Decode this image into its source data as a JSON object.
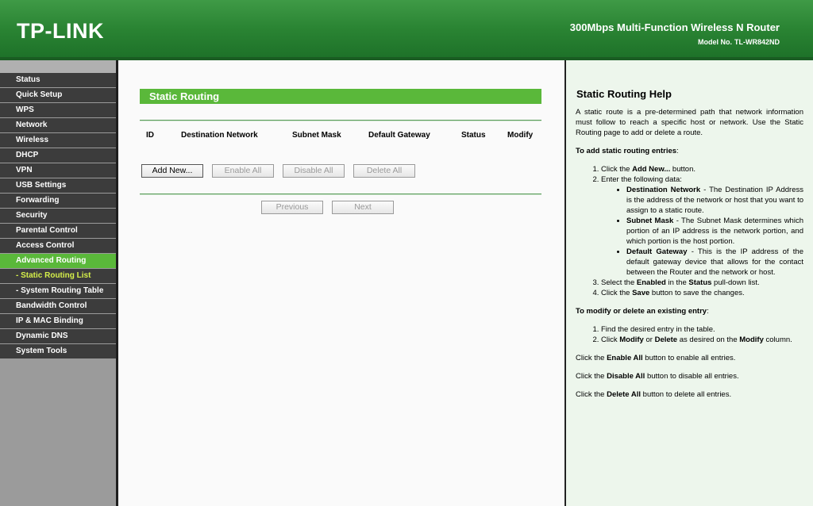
{
  "header": {
    "logo": "TP-LINK",
    "product": "300Mbps Multi-Function Wireless N Router",
    "model_label": "Model No.",
    "model_number": "TL-WR842ND"
  },
  "sidebar": {
    "items": [
      {
        "label": "Status"
      },
      {
        "label": "Quick Setup"
      },
      {
        "label": "WPS"
      },
      {
        "label": "Network"
      },
      {
        "label": "Wireless"
      },
      {
        "label": "DHCP"
      },
      {
        "label": "VPN"
      },
      {
        "label": "USB Settings"
      },
      {
        "label": "Forwarding"
      },
      {
        "label": "Security"
      },
      {
        "label": "Parental Control"
      },
      {
        "label": "Access Control"
      },
      {
        "label": "Advanced Routing"
      },
      {
        "label": "- Static Routing List"
      },
      {
        "label": "- System Routing Table"
      },
      {
        "label": "Bandwidth Control"
      },
      {
        "label": "IP & MAC Binding"
      },
      {
        "label": "Dynamic DNS"
      },
      {
        "label": "System Tools"
      }
    ]
  },
  "main": {
    "title": "Static Routing",
    "columns": [
      "ID",
      "Destination Network",
      "Subnet Mask",
      "Default Gateway",
      "Status",
      "Modify"
    ],
    "buttons": {
      "add_new": "Add New...",
      "enable_all": "Enable All",
      "disable_all": "Disable All",
      "delete_all": "Delete All",
      "previous": "Previous",
      "next": "Next"
    }
  },
  "help": {
    "title": "Static Routing Help",
    "intro": "A static route is a pre-determined path that network information must follow to reach a specific host or network. Use the Static Routing page to add or delete a route.",
    "add_heading": "To add static routing entries",
    "add_step1_pre": "Click the ",
    "add_step1_bold": "Add New...",
    "add_step1_post": " button.",
    "add_step2": "Enter the following data:",
    "dest_bold": "Destination Network",
    "dest_text": " - The Destination IP Address is the address of the network or host that you want to assign to a static route.",
    "mask_bold": "Subnet Mask",
    "mask_text": " - The Subnet Mask determines which portion of an IP address is the network portion, and which portion is the host portion.",
    "gw_bold": "Default Gateway",
    "gw_text": " - This is the IP address of the default gateway device that allows for the contact between the Router and the network or host.",
    "add_step3_pre": "Select the ",
    "add_step3_bold1": "Enabled",
    "add_step3_mid": " in the ",
    "add_step3_bold2": "Status",
    "add_step3_post": " pull-down list.",
    "add_step4_pre": "Click the ",
    "add_step4_bold": "Save",
    "add_step4_post": " button to save the changes.",
    "modify_heading": "To modify or delete an existing entry",
    "mod_step1": "Find the desired entry in the table.",
    "mod_step2_pre": "Click ",
    "mod_step2_bold1": "Modify",
    "mod_step2_or": " or ",
    "mod_step2_bold2": "Delete",
    "mod_step2_mid": " as desired on the ",
    "mod_step2_bold3": "Modify",
    "mod_step2_post": " column.",
    "enable_pre": "Click the ",
    "enable_bold": "Enable All",
    "enable_post": " button to enable all entries.",
    "disable_pre": "Click the ",
    "disable_bold": "Disable All",
    "disable_post": " button to disable all entries.",
    "delete_pre": "Click the ",
    "delete_bold": "Delete All",
    "delete_post": " button to delete all entries."
  },
  "colors": {
    "accent_green": "#5ab83a",
    "header_green": "#2a8433",
    "menu_dark": "#3c3c3c",
    "submenu_highlight": "#d6f04a",
    "help_background": "#edf6ec"
  }
}
